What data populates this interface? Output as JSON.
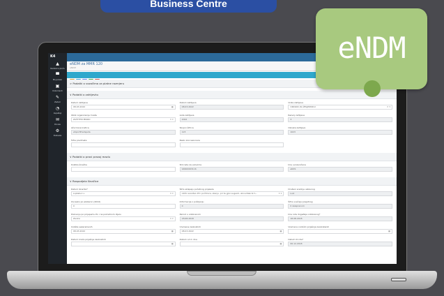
{
  "banner": {
    "text": "Business Centre"
  },
  "badge": {
    "text": "eNDM"
  },
  "app": {
    "logo": "K4",
    "menu_icon": "≡",
    "page_title": "eNDM za MMR 120",
    "breadcrumb": "eNDM",
    "sidebar": [
      {
        "icon": "▲",
        "label": "Nadzorna ploča"
      },
      {
        "icon": "▀",
        "label": "Moj posao"
      },
      {
        "icon": "▣",
        "label": "Dokumenti"
      },
      {
        "icon": "✎",
        "label": "Zadaci"
      },
      {
        "icon": "◔",
        "label": "Izvještaji"
      },
      {
        "icon": "✉",
        "label": "Poruke"
      },
      {
        "icon": "⚙",
        "label": "Postavke"
      }
    ],
    "toolbar_buttons": [
      "save",
      "new",
      "copy",
      "print",
      "delete"
    ],
    "sections": [
      {
        "title": "> Podatki o vozačima za platne razmjeru",
        "rows": []
      },
      {
        "title": "∨ Podatki o zahtjevku",
        "rows": [
          [
            {
              "label": "Datum zahtjeva",
              "value": "08.03.2022",
              "ro": false,
              "icon": "cal"
            },
            {
              "label": "Datum zahtjeva",
              "value": "08.03.2022",
              "ro": true,
              "icon": ""
            },
            {
              "label": "Vrsta zahtjeva",
              "value": "OPASNO ZA ŽELJEZNICU",
              "ro": false,
              "icon": "dd"
            }
          ],
          [
            {
              "label": "Oblik organizacije mreže",
              "value": "ZAŠTITNI MIKRO",
              "ro": false,
              "icon": "dd"
            },
            {
              "label": "Lista zahtjeva",
              "value": "2022",
              "ro": true,
              "icon": ""
            },
            {
              "label": "Razvoj zahtjeva",
              "value": "3",
              "ro": true,
              "icon": ""
            }
          ],
          [
            {
              "label": "Ažurirana kratica",
              "value": "eSportPredsjeda",
              "ro": true,
              "icon": ""
            },
            {
              "label": "Skupni šifrica",
              "value": "123",
              "ro": true,
              "icon": ""
            },
            {
              "label": "Oznaka zahtjeva",
              "value": "1023",
              "ro": true,
              "icon": ""
            }
          ],
          [
            {
              "label": "Šifra predmeta",
              "value": "",
              "ro": false,
              "icon": ""
            },
            {
              "label": "Naziv koncesionara",
              "value": "",
              "ro": false,
              "icon": ""
            },
            {
              "label": "",
              "value": "",
              "ro": false,
              "icon": "none"
            }
          ]
        ]
      },
      {
        "title": "∨ Podatki o pravi pravoj mazlu",
        "rows": [
          [
            {
              "label": "Kratika šinačke",
              "value": "",
              "ro": false,
              "icon": ""
            },
            {
              "label": "Stil rada za uslovima",
              "value": "94600063116",
              "ro": true,
              "icon": ""
            },
            {
              "label": "Ime uvozeničana",
              "value": "eKDS",
              "ro": true,
              "icon": ""
            }
          ]
        ]
      },
      {
        "title": "∨ Raspodjela šinačice",
        "rows": [
          [
            {
              "label": "Datum šinačke*",
              "value": "Loptaturi u",
              "ro": false,
              "icon": "dd"
            },
            {
              "label": "Šifra sklapaju početnog prijelaza",
              "value": "Ulički aranžan P3 i počitnica, stanju, pri te gjivi sugesti, ulinovitakcik h...",
              "ro": false,
              "icon": "dd"
            },
            {
              "label": "Druženi srednje ustavnog",
              "value": "Loxl",
              "ro": true,
              "icon": ""
            }
          ],
          [
            {
              "label": "Ovcesko po eksteron (2022)",
              "value": "0",
              "ro": false,
              "icon": ""
            },
            {
              "label": "Informacije o pošiljanju",
              "value": "0",
              "ro": true,
              "icon": ""
            },
            {
              "label": "Šifra uvečaja posjetnog",
              "value": "0 zeleprenom",
              "ro": true,
              "icon": ""
            }
          ],
          [
            {
              "label": "Poznanju po prijepemu Po i na pokretnom dijelu",
              "value": "Zaokvi",
              "ro": false,
              "icon": "dd"
            },
            {
              "label": "Period u odobrenom",
              "value": "18.08.2018",
              "ro": true,
              "icon": ""
            },
            {
              "label": "Ime rute događaja odobrenog*",
              "value": "18.08.2018",
              "ro": true,
              "icon": ""
            }
          ],
          [
            {
              "label": "Uobšte sekerskrenih",
              "value": "08.03.2022",
              "ro": false,
              "icon": "cal"
            },
            {
              "label": "Vremena zaokretnih",
              "value": "08.03.2022",
              "ro": false,
              "icon": "cal"
            },
            {
              "label": "Vremena ondošm prijašnja zaokretanih",
              "value": "",
              "ro": false,
              "icon": "cal"
            }
          ],
          [
            {
              "label": "Datum kraća prijašnja zaokretnih",
              "value": "",
              "ro": false,
              "icon": "cal"
            },
            {
              "label": "Datum od d. dne",
              "value": "",
              "ro": false,
              "icon": "cal"
            },
            {
              "label": "Datum 01.die*",
              "value": "06.12.2018",
              "ro": true,
              "icon": ""
            }
          ]
        ]
      }
    ]
  },
  "colors": {
    "sidebar": "#20252b",
    "topbar": "#2c6a9a",
    "toolbar": "#2fa8cc",
    "badge": "#a8c97f",
    "banner": "#2b4fa3"
  }
}
